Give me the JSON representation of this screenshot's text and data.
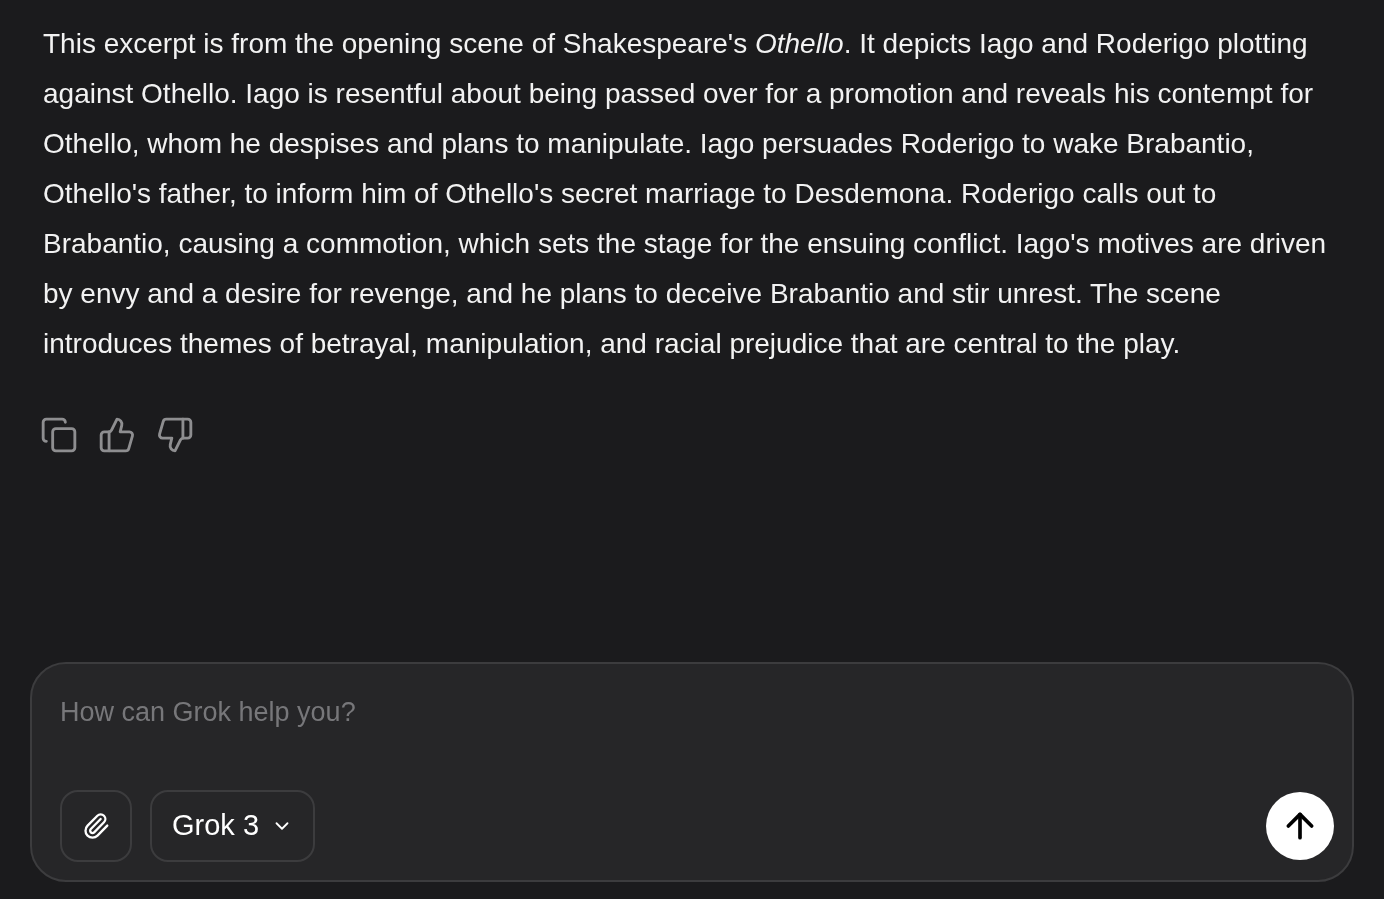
{
  "message": {
    "text": "This excerpt is from the opening scene of Shakespeare's *Othello*. It depicts Iago and Roderigo plotting against Othello. Iago is resentful about being passed over for a promotion and reveals his contempt for Othello, whom he despises and plans to manipulate. Iago persuades Roderigo to wake Brabantio, Othello's father, to inform him of Othello's secret marriage to Desdemona. Roderigo calls out to Brabantio, causing a commotion, which sets the stage for the ensuing conflict. Iago's motives are driven by envy and a desire for revenge, and he plans to deceive Brabantio and stir unrest. The scene introduces themes of betrayal, manipulation, and racial prejudice that are central to the play."
  },
  "composer": {
    "placeholder": "How can Grok help you?",
    "model": "Grok 3"
  }
}
